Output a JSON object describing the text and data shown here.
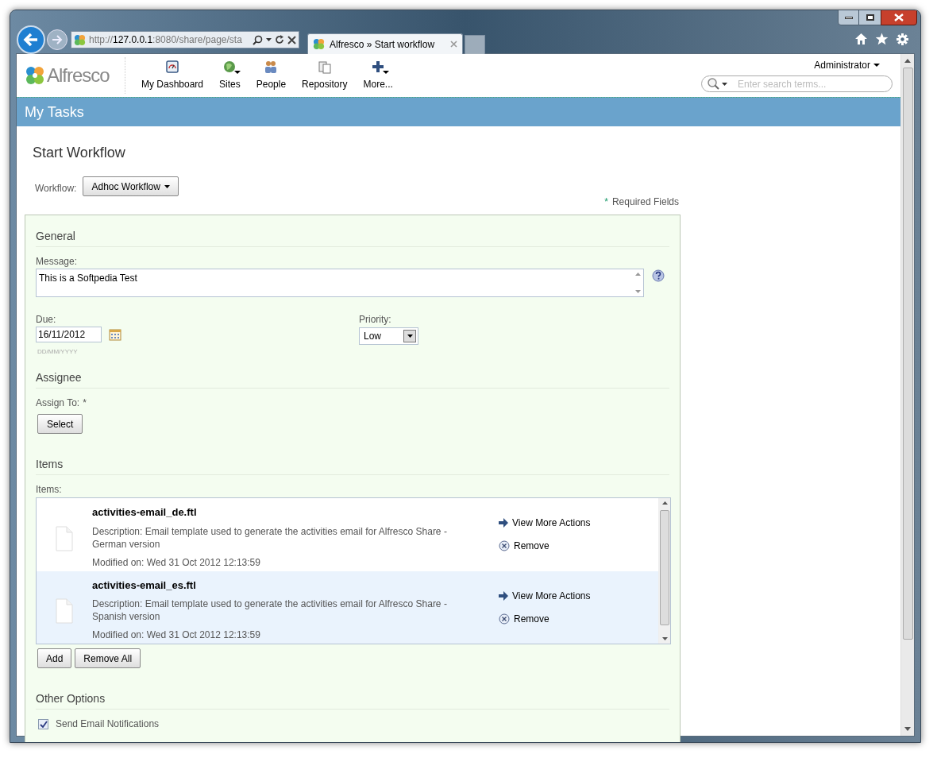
{
  "browser": {
    "address_prefix": "http://",
    "address_host": "127.0.0.1",
    "address_rest": ":8080/share/page/sta",
    "tab_title": "Alfresco » Start workflow"
  },
  "header": {
    "logo": "Alfresco",
    "nav": [
      {
        "label": "My Dashboard",
        "kind": "dashboard",
        "dropdown": false
      },
      {
        "label": "Sites",
        "kind": "sites",
        "dropdown": true
      },
      {
        "label": "People",
        "kind": "people",
        "dropdown": false
      },
      {
        "label": "Repository",
        "kind": "repository",
        "dropdown": false
      },
      {
        "label": "More...",
        "kind": "more",
        "dropdown": true
      }
    ],
    "user": "Administrator",
    "search_placeholder": "Enter search terms..."
  },
  "title_bar": "My Tasks",
  "page_title": "Start Workflow",
  "workflow": {
    "label": "Workflow:",
    "value": "Adhoc Workflow"
  },
  "required_note": {
    "mark": "*",
    "text": "Required Fields"
  },
  "sections": {
    "general": "General",
    "assignee": "Assignee",
    "items": "Items",
    "other": "Other Options"
  },
  "message": {
    "label": "Message:",
    "value": "This is a Softpedia Test"
  },
  "due": {
    "label": "Due:",
    "value": "16/11/2012",
    "hint": "DD/MM/YYYY"
  },
  "priority": {
    "label": "Priority:",
    "value": "Low"
  },
  "assign": {
    "label": "Assign To:",
    "mark": "*",
    "button": "Select"
  },
  "items_label": "Items:",
  "items": [
    {
      "name": "activities-email_de.ftl",
      "description": "Description: Email template used to generate the activities email for Alfresco Share - German version",
      "modified": "Modified on: Wed 31 Oct 2012 12:13:59",
      "actions": [
        "View More Actions",
        "Remove"
      ],
      "selected": false
    },
    {
      "name": "activities-email_es.ftl",
      "description": "Description: Email template used to generate the activities email for Alfresco Share - Spanish version",
      "modified": "Modified on: Wed 31 Oct 2012 12:13:59",
      "actions": [
        "View More Actions",
        "Remove"
      ],
      "selected": true
    }
  ],
  "item_buttons": [
    "Add",
    "Remove All"
  ],
  "options": [
    {
      "label": "Send Email Notifications",
      "checked": true
    }
  ]
}
